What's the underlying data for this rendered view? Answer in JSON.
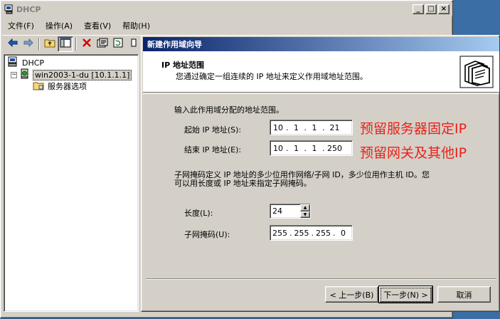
{
  "main": {
    "title": "DHCP",
    "menu": [
      {
        "label": "文件(F)"
      },
      {
        "label": "操作(A)"
      },
      {
        "label": "查看(V)"
      },
      {
        "label": "帮助(H)"
      }
    ],
    "tree": {
      "root": "DHCP",
      "server": "win2003-1-du [10.1.1.1]",
      "options": "服务器选项"
    }
  },
  "wizard": {
    "title": "新建作用域向导",
    "header_title": "IP 地址范围",
    "header_desc": "您通过确定一组连续的 IP 地址来定义作用域地址范围。",
    "intro": "输入此作用域分配的地址范围。",
    "start_label": "起始 IP 地址(S):",
    "start_ip": [
      "10",
      "1",
      "1",
      "21"
    ],
    "end_label": "结束 IP 地址(E):",
    "end_ip": [
      "10",
      "1",
      "1",
      "250"
    ],
    "annot_start": "预留服务器固定IP",
    "annot_end": "预留网关及其他IP",
    "mask_desc_1": "子网掩码定义 IP 地址的多少位用作网络/子网 ID，多少位用作主机 ID。您",
    "mask_desc_2": "可以用长度或 IP 地址来指定子网掩码。",
    "length_label": "长度(L):",
    "length_value": "24",
    "mask_label": "子网掩码(U):",
    "mask_ip": [
      "255",
      "255",
      "255",
      "0"
    ],
    "btn_back": "< 上一步(B)",
    "btn_next": "下一步(N) >",
    "btn_cancel": "取消"
  },
  "colors": {
    "annotation": "#e8231a",
    "title_gradient_start": "#0a246a",
    "title_gradient_end": "#a6caf0",
    "face": "#d4d0c8"
  },
  "icons": [
    "dhcp-app-icon",
    "back-arrow-icon",
    "forward-arrow-icon",
    "up-folder-icon",
    "show-hide-tree-icon",
    "delete-icon",
    "properties-icon",
    "refresh-icon",
    "server-icon",
    "folder-icon",
    "wizard-folders-icon"
  ]
}
